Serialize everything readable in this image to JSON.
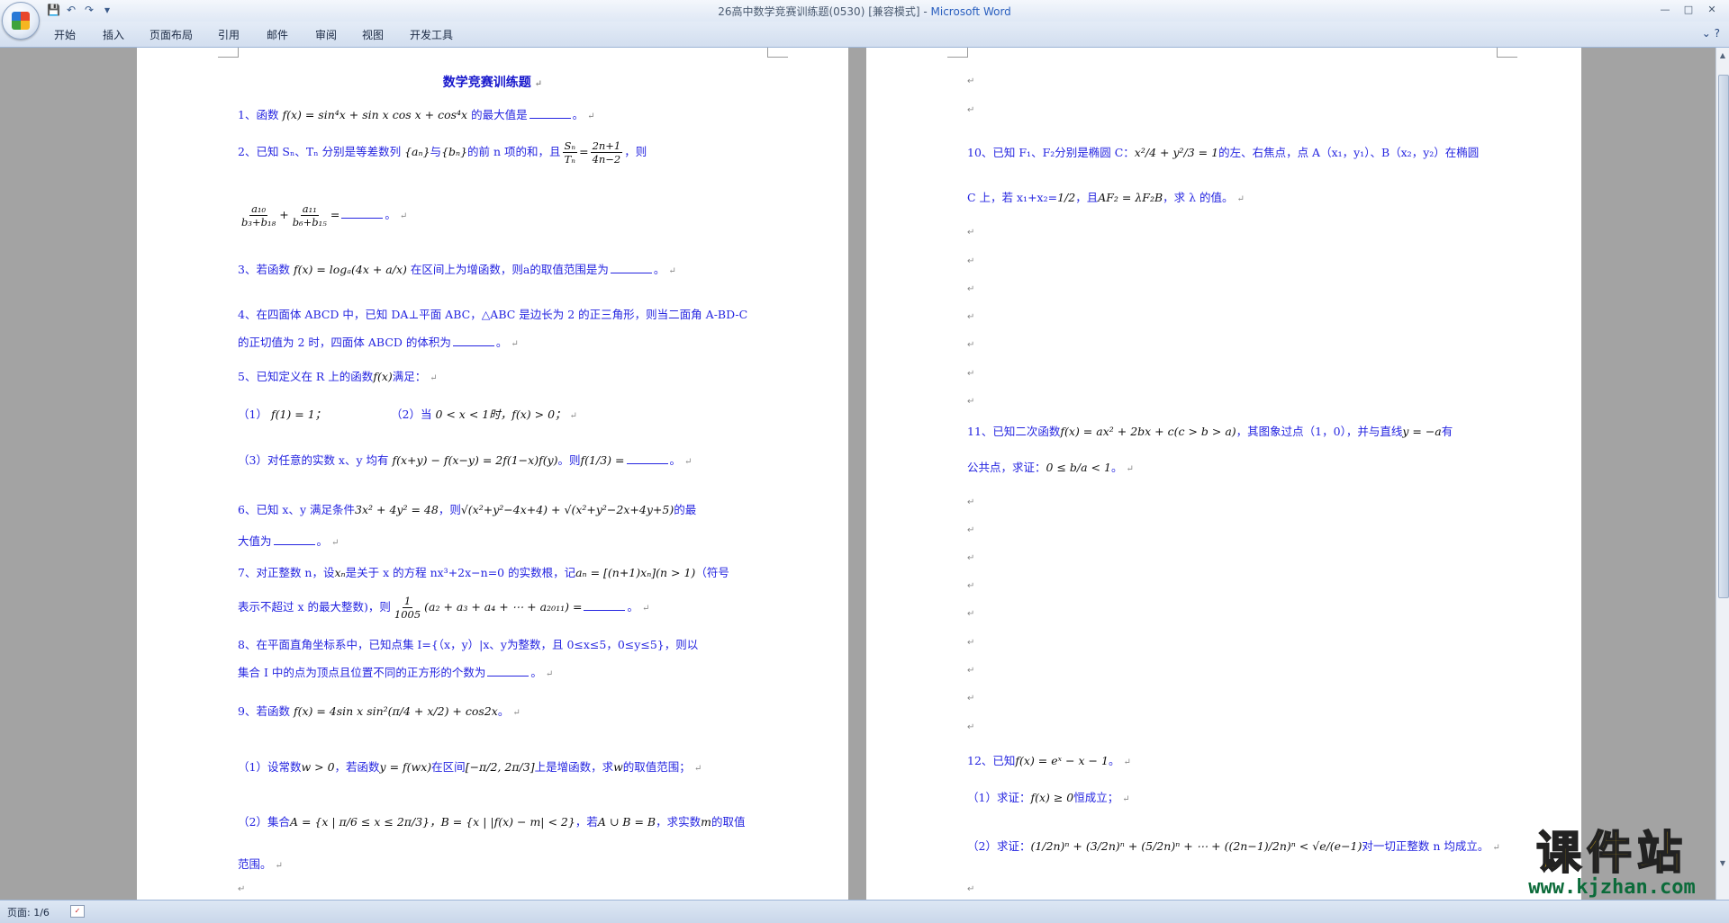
{
  "window": {
    "title_doc": "26高中数学竞赛训练题(0530) [兼容模式] - ",
    "title_app": "Microsoft Word"
  },
  "qat": {
    "save": "💾",
    "undo": "↶",
    "redo": "↷",
    "customize": "▾"
  },
  "menu": {
    "tabs": [
      "开始",
      "插入",
      "页面布局",
      "引用",
      "邮件",
      "审阅",
      "视图",
      "开发工具"
    ]
  },
  "doc": {
    "title": "数学竞赛训练题",
    "p1": "1、函数",
    "p1_math": "f(x) = sin⁴x + sin x cos x + cos⁴x",
    "p1_tail": "的最大值是",
    "p2a": "2、已知 Sₙ、Tₙ 分别是等差数列",
    "p2_math1": "{aₙ}",
    "p2_mid": "与",
    "p2_math2": "{bₙ}",
    "p2_b": "的前 n 项的和，且",
    "p2_fn": "Sₙ",
    "p2_fd": "Tₙ",
    "p2_eq": "=",
    "p2_gn": "2n+1",
    "p2_gd": "4n−2",
    "p2_c": "，则",
    "p2_f1n": "a₁₀",
    "p2_f1d": "b₃+b₁₈",
    "p2_plus": "+",
    "p2_f2n": "a₁₁",
    "p2_f2d": "b₆+b₁₅",
    "p2_eq2": "=",
    "p3": "3、若函数",
    "p3_math": "f(x) = logₐ(4x + a/x)",
    "p3_tail": "在区间上为增函数，则a的取值范围是为",
    "p4a": "4、在四面体 ABCD 中，已知 DA⊥平面 ABC，△ABC 是边长为 2 的正三角形，则当二面角 A-BD-C",
    "p4b": "的正切值为 2 时，四面体 ABCD 的体积为",
    "p5": "5、已知定义在 R 上的函数",
    "p5_math": "f(x)",
    "p5_tail": "满足：",
    "p5_1": "（1）",
    "p5_1m": "f(1) = 1；",
    "p5_2": "（2）当",
    "p5_2m": "0 < x < 1时，f(x) > 0；",
    "p5_3": "（3）对任意的实数 x、y 均有",
    "p5_3m": "f(x+y) − f(x−y) = 2f(1−x)f(y)",
    "p5_3t": "。则",
    "p5_3q": "f(1/3) =",
    "p6a": "6、已知 x、y 满足条件",
    "p6_math": "3x² + 4y² = 48",
    "p6_mid": "，则",
    "p6_math2": "√(x²+y²−4x+4) + √(x²+y²−2x+4y+5)",
    "p6_tail": "的最",
    "p6b": "大值为",
    "p7a": "7、对正整数 n，设",
    "p7_m1": "xₙ",
    "p7_mid": "是关于 x 的方程 nx³+2x−n=0 的实数根，记",
    "p7_m2": "aₙ = [(n+1)xₙ](n > 1)",
    "p7_tail": "（符号",
    "p7b": "表示不超过 x 的最大整数)，则",
    "p7_fn": "1",
    "p7_fd": "1005",
    "p7_m3": "(a₂ + a₃ + a₄ + ⋯ + a₂₀₁₁) =",
    "p8a": "8、在平面直角坐标系中，已知点集 I={（x，y）|x、y为整数，且 0≤x≤5，0≤y≤5}，则以",
    "p8b": "集合 I 中的点为顶点且位置不同的正方形的个数为",
    "p9": "9、若函数",
    "p9_math": "f(x) = 4sin x sin²(π/4 + x/2) + cos2x",
    "p9_tail": "。",
    "p9_1": "（1）设常数",
    "p9_1m": "w > 0",
    "p9_1b": "，若函数",
    "p9_1m2": "y = f(wx)",
    "p9_1c": "在区间",
    "p9_1m3": "[−π/2, 2π/3]",
    "p9_1d": "上是增函数，求",
    "p9_1m4": "w",
    "p9_1e": "的取值范围；",
    "p9_2": "（2）集合",
    "p9_2m": "A = {x | π/6 ≤ x ≤ 2π/3}，B = {x | |f(x) − m| < 2}",
    "p9_2b": "，若",
    "p9_2m2": "A ∪ B = B",
    "p9_2c": "，求实数",
    "p9_2m3": "m",
    "p9_2d": "的取值",
    "p9_2e": "范围。",
    "p10a": "10、已知 F₁、F₂分别是椭圆 C：",
    "p10_m1": "x²/4 + y²/3 = 1",
    "p10_b": "的左、右焦点，点 A（x₁，y₁）、B（x₂，y₂）在椭圆",
    "p10c": "C 上，若 x₁+x₂=",
    "p10_m2": "1/2",
    "p10_d": "，且",
    "p10_m3": "AF₂ = λF₂B",
    "p10_e": "，求 λ 的值。",
    "p11a": "11、已知二次函数",
    "p11_m1": "f(x) = ax² + 2bx + c(c > b > a)",
    "p11_b": "，其图象过点（1，0），并与直线",
    "p11_m2": "y = −a",
    "p11_c": "有",
    "p11d": "公共点，求证：",
    "p11_m3": "0 ≤ b/a < 1",
    "p11_e": "。",
    "p12": "12、已知",
    "p12_m": "f(x) = eˣ − x − 1",
    "p12_t": "。",
    "p12_1": "（1）求证：",
    "p12_1m": "f(x) ≥ 0",
    "p12_1t": "恒成立；",
    "p12_2": "（2）求证：",
    "p12_2m": "(1/2n)ⁿ + (3/2n)ⁿ + (5/2n)ⁿ + ⋯ + ((2n−1)/2n)ⁿ < √e/(e−1)",
    "p12_2t": "对一切正整数 n 均成立。",
    "mark": "↵",
    "period": "。"
  },
  "status": {
    "page": "页面: 1/6"
  },
  "watermark": {
    "text": "课件站",
    "url": "www.kjzhan.com"
  }
}
